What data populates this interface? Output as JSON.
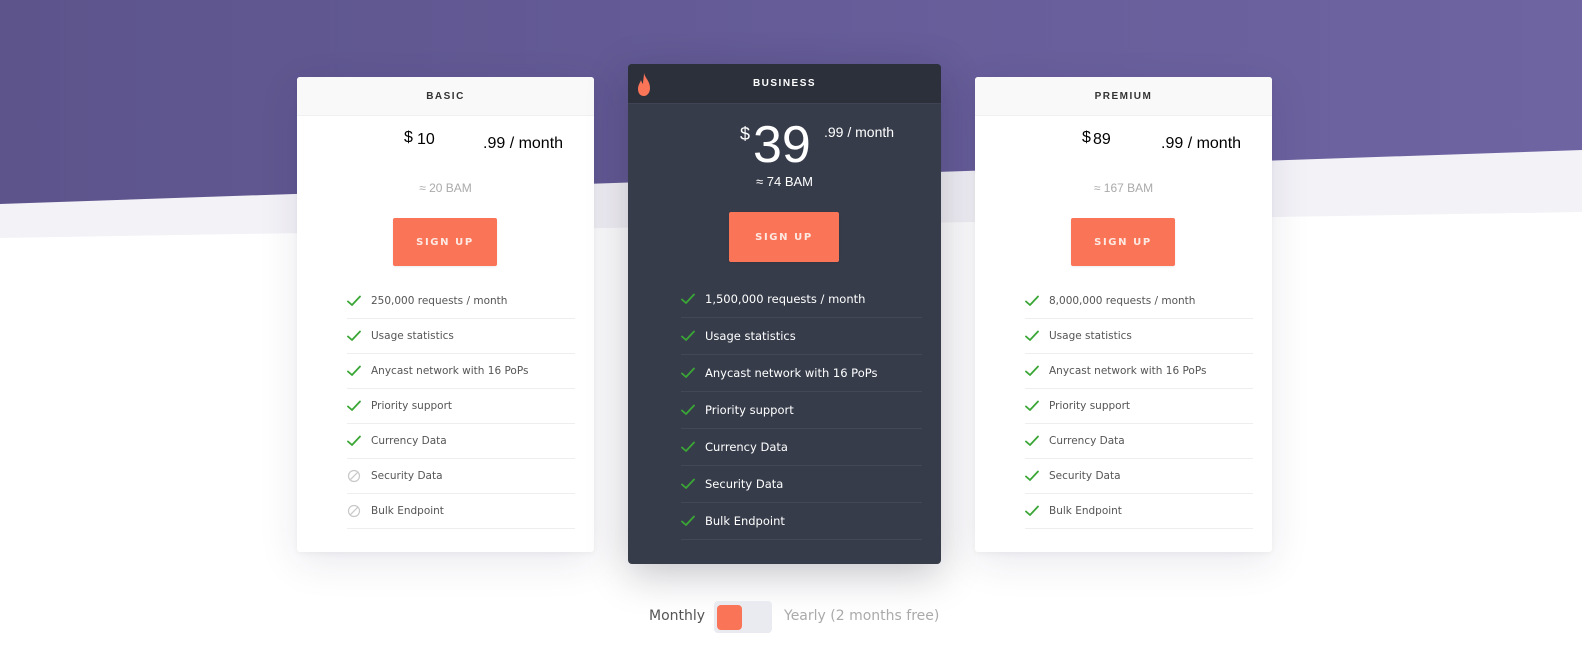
{
  "colors": {
    "hero_purple": "#61588f",
    "accent": "#fa7458",
    "check_green": "#3aa635",
    "business_bg": "#363c4a"
  },
  "plans": [
    {
      "name": "BASIC",
      "currency": "$",
      "amount": "10",
      "cents_period": ".99 / month",
      "approx": "≈ 20 BAM",
      "button": "SIGN UP",
      "features": [
        {
          "label": "250,000 requests / month",
          "included": true,
          "icon": "check-icon"
        },
        {
          "label": "Usage statistics",
          "included": true,
          "icon": "check-icon"
        },
        {
          "label": "Anycast network with 16 PoPs",
          "included": true,
          "icon": "check-icon"
        },
        {
          "label": "Priority support",
          "included": true,
          "icon": "check-icon"
        },
        {
          "label": "Currency Data",
          "included": true,
          "icon": "check-icon"
        },
        {
          "label": "Security Data",
          "included": false,
          "icon": "not-allowed-icon"
        },
        {
          "label": "Bulk Endpoint",
          "included": false,
          "icon": "not-allowed-icon"
        }
      ]
    },
    {
      "name": "BUSINESS",
      "badge_icon": "flame-icon",
      "currency": "$",
      "amount": "39",
      "cents_period": ".99 / month",
      "approx": "≈ 74 BAM",
      "button": "SIGN UP",
      "features": [
        {
          "label": "1,500,000 requests / month",
          "included": true,
          "icon": "check-icon"
        },
        {
          "label": "Usage statistics",
          "included": true,
          "icon": "check-icon"
        },
        {
          "label": "Anycast network with 16 PoPs",
          "included": true,
          "icon": "check-icon"
        },
        {
          "label": "Priority support",
          "included": true,
          "icon": "check-icon"
        },
        {
          "label": "Currency Data",
          "included": true,
          "icon": "check-icon"
        },
        {
          "label": "Security Data",
          "included": true,
          "icon": "check-icon"
        },
        {
          "label": "Bulk Endpoint",
          "included": true,
          "icon": "check-icon"
        }
      ]
    },
    {
      "name": "PREMIUM",
      "currency": "$",
      "amount": "89",
      "cents_period": ".99 / month",
      "approx": "≈ 167 BAM",
      "button": "SIGN UP",
      "features": [
        {
          "label": "8,000,000 requests / month",
          "included": true,
          "icon": "check-icon"
        },
        {
          "label": "Usage statistics",
          "included": true,
          "icon": "check-icon"
        },
        {
          "label": "Anycast network with 16 PoPs",
          "included": true,
          "icon": "check-icon"
        },
        {
          "label": "Priority support",
          "included": true,
          "icon": "check-icon"
        },
        {
          "label": "Currency Data",
          "included": true,
          "icon": "check-icon"
        },
        {
          "label": "Security Data",
          "included": true,
          "icon": "check-icon"
        },
        {
          "label": "Bulk Endpoint",
          "included": true,
          "icon": "check-icon"
        }
      ]
    }
  ],
  "billing_toggle": {
    "monthly_label": "Monthly",
    "yearly_label": "Yearly (2 months free)",
    "selected": "Monthly"
  }
}
